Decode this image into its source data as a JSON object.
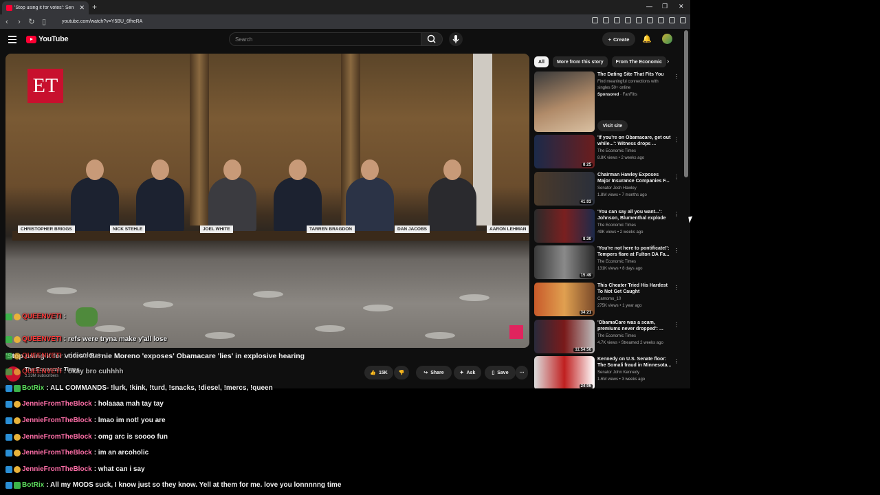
{
  "browser": {
    "tab_title": "'Stop using it for votes': Sen",
    "url": "youtube.com/watch?v=Y5BU_6fheRA"
  },
  "youtube": {
    "logo": "YouTube",
    "search_placeholder": "Search",
    "create_label": "Create"
  },
  "video": {
    "nameplates": [
      "CHRISTOPHER BRIGGS",
      "NICK STEHLE",
      "JOEL WHITE",
      "TARREN BRAGDON",
      "DAN JACOBS",
      "AARON LEHMAN"
    ],
    "channel_logo": "ET",
    "title": "'Stop using it for votes': Bernie Moreno 'exposes' Obamacare 'lies' in explosive hearing",
    "channel": "The Economic Times",
    "subscribers": "3.33M subscribers",
    "likes": "15K",
    "share": "Share",
    "ask": "Ask",
    "save": "Save"
  },
  "chat": [
    {
      "user": "QUEENVETI",
      "message": ":",
      "color": "red"
    },
    {
      "user": "QUEENVETI",
      "message": ": refs were tryna make y'all lose",
      "color": "red"
    },
    {
      "user": "QUEENVETI",
      "message": ": ridiculous",
      "color": "red"
    },
    {
      "user": "QUEENVETI",
      "message": ": okay bro cuhhhh",
      "color": "red"
    },
    {
      "user": "BotRix",
      "message": ": ALL COMMANDS- !lurk, !kink, !turd, !snacks, !diesel, !mercs, !queen",
      "color": "green"
    },
    {
      "user": "JennieFromTheBlock",
      "message": ": holaaaa mah tay tay",
      "color": "pink"
    },
    {
      "user": "JennieFromTheBlock",
      "message": ": lmao im not! you are",
      "color": "pink"
    },
    {
      "user": "JennieFromTheBlock",
      "message": ": omg arc is soooo fun",
      "color": "pink"
    },
    {
      "user": "JennieFromTheBlock",
      "message": ": im an arcoholic",
      "color": "pink"
    },
    {
      "user": "JennieFromTheBlock",
      "message": ": what can i say",
      "color": "pink"
    },
    {
      "user": "BotRix",
      "message": ": All my MODS suck, I know just so they know. Yell at them for me. love you lonnnnng time",
      "color": "green"
    }
  ],
  "sidebar": {
    "chips": [
      "All",
      "More from this story",
      "From The Economic"
    ],
    "ad": {
      "title": "The Dating Site That Fits You",
      "desc": "Find meaningful connections with singles 50+ online",
      "sponsored": "Sponsored",
      "advertiser": "· FanFilts",
      "cta": "Visit site"
    },
    "videos": [
      {
        "title": "'If you're on Obamacare, get out while...': Witness drops ...",
        "channel": "The Economic Times",
        "meta": "8.8K views • 2 weeks ago",
        "duration": "8:25"
      },
      {
        "title": "Chairman Hawley Exposes Major Insurance Companies F...",
        "channel": "Senator Josh Hawley",
        "meta": "1.8M views • 7 months ago",
        "duration": "41:03"
      },
      {
        "title": "'You can say all you want...': Johnson, Blumenthal explode i...",
        "channel": "The Economic Times",
        "meta": "49K views • 2 weeks ago",
        "duration": "8:30"
      },
      {
        "title": "'You're not here to pontificate!': Tempers flare at Fulton DA Fa...",
        "channel": "The Economic Times",
        "meta": "131K views • 8 days ago",
        "duration": "15:49"
      },
      {
        "title": "This Cheater Tried His Hardest To Not Get Caught",
        "channel": "Camomo_10",
        "meta": "275K views • 1 year ago",
        "duration": "34:21"
      },
      {
        "title": "'ObamaCare was a scam, premiums never dropped': ...",
        "channel": "The Economic Times",
        "meta": "4.7K views • Streamed 2 weeks ago",
        "duration": "11:54:56"
      },
      {
        "title": "Kennedy on U.S. Senate floor: The Somali fraud in Minnesota...",
        "channel": "Senator John Kennedy",
        "meta": "1.6M views • 3 weeks ago",
        "duration": "24:06"
      }
    ]
  }
}
